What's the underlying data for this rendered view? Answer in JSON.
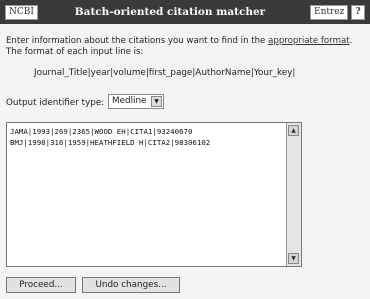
{
  "header": {
    "ncbi_label": "NCBI",
    "title": "Batch-oriented citation matcher",
    "entrez_label": "Entrez",
    "help_label": "?"
  },
  "intro": {
    "text_before_link": "Enter information about the citations you want to find in the ",
    "link_text": "appropriate format",
    "text_after_link": ". The format of each input line is:"
  },
  "format_line": "Journal_Title|year|volume|first_page|AuthorName|Your_key|",
  "output": {
    "label": "Output identifier type:",
    "selected": "Medline"
  },
  "citations": {
    "line1": "JAMA|1993|269|2365|WOOD EH|CITA1|93240670",
    "line2": "BMJ|1998|316|1959|HEATHFIELD H|CITA2|98306102"
  },
  "buttons": {
    "proceed": "Proceed...",
    "undo": "Undo changes..."
  },
  "icons": {
    "dropdown": "chevron-down-icon",
    "scroll_up": "arrow-up-icon",
    "scroll_down": "arrow-down-icon"
  }
}
